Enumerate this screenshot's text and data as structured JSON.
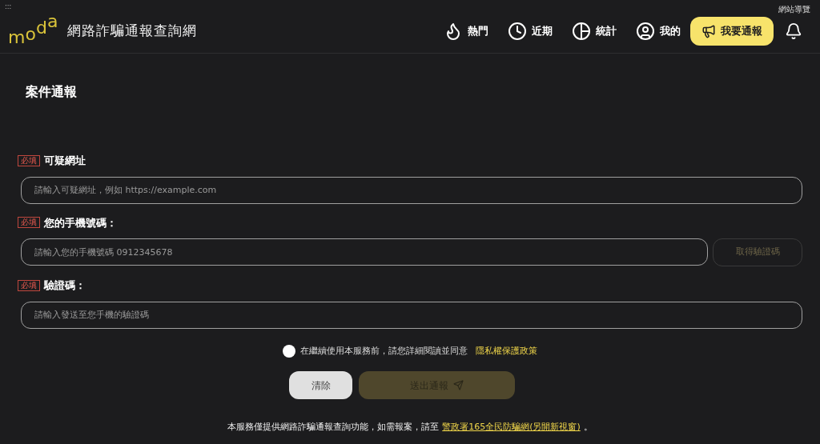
{
  "top_bar": {
    "menu_icon": ":::",
    "site_map": "網站導覽"
  },
  "header": {
    "logo": [
      "m",
      "o",
      "d",
      "a"
    ],
    "title": "網路詐騙通報查詢網",
    "nav": [
      {
        "kind": "hot",
        "label": "熱門"
      },
      {
        "kind": "recent",
        "label": "近期"
      },
      {
        "kind": "stats",
        "label": "統計"
      },
      {
        "kind": "mine",
        "label": "我的"
      }
    ],
    "report_button": "我要通報"
  },
  "page_title": "案件通報",
  "fields": [
    {
      "required": "必填",
      "label": "可疑網址",
      "placeholder": "請輸入可疑網址，例如 https://example.com"
    },
    {
      "required": "必填",
      "label": "您的手機號碼：",
      "placeholder": "請輸入您的手機號碼 0912345678",
      "button": {
        "label": "取得驗證碼",
        "disabled": true
      }
    },
    {
      "required": "必填",
      "label": "驗證碼：",
      "placeholder": "請輸入發送至您手機的驗證碼"
    }
  ],
  "agreement": {
    "checked": false,
    "text": "在繼續使用本服務前，請您詳細閱讀並同意",
    "link": "隱私權保護政策"
  },
  "buttons": {
    "clear": "清除",
    "submit": {
      "label": "送出通報",
      "disabled": true
    }
  },
  "footer": {
    "text": "本服務僅提供網路詐騙通報查詢功能，如需報案，請至",
    "link": "警政署165全民防騙網(另開新視窗)",
    "end": "。"
  }
}
